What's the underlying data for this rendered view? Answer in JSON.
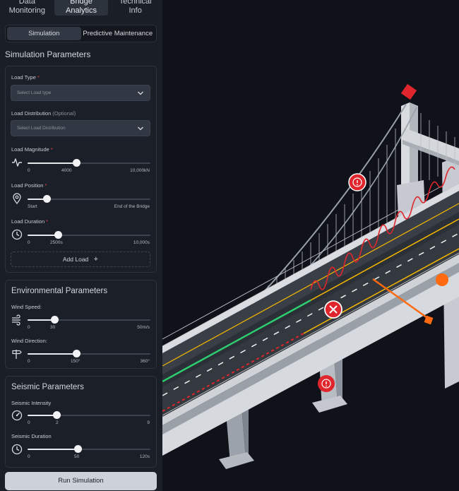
{
  "main_tabs": [
    {
      "label_l1": "Data",
      "label_l2": "Monitoring"
    },
    {
      "label_l1": "Bridge",
      "label_l2": "Analytics"
    },
    {
      "label_l1": "Technical",
      "label_l2": "Info"
    }
  ],
  "sub_tabs": [
    "Simulation",
    "Predictive Maintenance"
  ],
  "simulation_title": "Simulation Parameters",
  "load_type": {
    "label": "Load Type",
    "required": "*",
    "placeholder": "Select Load type"
  },
  "load_distribution": {
    "label": "Load Distribution",
    "optional": "(Optional)",
    "placeholder": "Select Load Distribution"
  },
  "load_magnitude": {
    "label": "Load Magnitude",
    "required": "*",
    "min": "0",
    "value_label": "4000",
    "max": "10,000kN",
    "value": 0.4,
    "icon": "pulse-icon"
  },
  "load_position": {
    "label": "Load Position",
    "required": "*",
    "min": "Start",
    "max": "End of the Bridge",
    "value": 0.16,
    "icon": "location-pin-icon"
  },
  "load_duration": {
    "label": "Load Duration",
    "required": "*",
    "min": "0",
    "value_label": "2500s",
    "max": "10,000s",
    "value": 0.25,
    "icon": "clock-icon"
  },
  "add_load": {
    "label": "Add Load",
    "icon": "plus-icon"
  },
  "environmental": {
    "title": "Environmental Parameters",
    "wind_speed": {
      "label": "Wind Speed:",
      "min": "0",
      "value_label": "30",
      "max": "50m/s",
      "value": 0.22,
      "icon": "wind-icon"
    },
    "wind_direction": {
      "label": "Wind Direction:",
      "min": "0",
      "value_label": "150°",
      "max": "360°",
      "value": 0.4,
      "icon": "signpost-icon"
    }
  },
  "seismic": {
    "title": "Seismic Parameters",
    "intensity": {
      "label": "Seismic Intensity",
      "min": "0",
      "value_label": "2",
      "max": "9",
      "value": 0.24,
      "icon": "gauge-icon"
    },
    "duration": {
      "label": "Seismic Duration",
      "min": "0",
      "value_label": "50",
      "max": "120s",
      "value": 0.41,
      "icon": "clock-icon"
    }
  },
  "run_button": "Run Simulation",
  "colors": {
    "accent": "#e6e8ec",
    "required": "#e0424a",
    "alert": "#e0262c",
    "wind_marker": "#ff6a10",
    "safe_line": "#2ecc71",
    "load_wave": "#e0262c",
    "lane_yellow": "#f5b800"
  }
}
